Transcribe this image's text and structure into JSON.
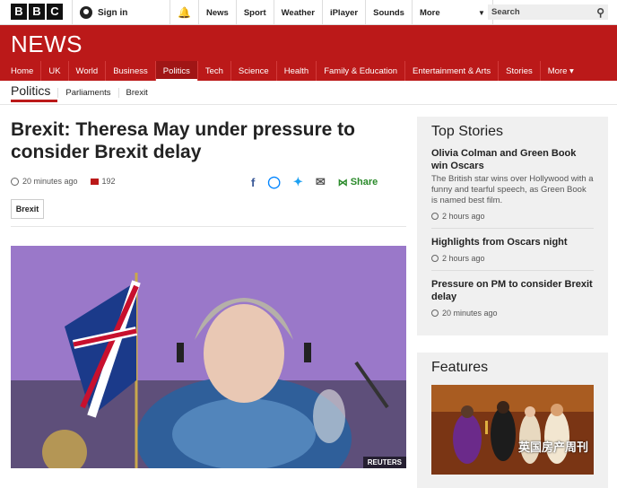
{
  "bbc_logo": [
    "B",
    "B",
    "C"
  ],
  "topbar": {
    "signin": "Sign in",
    "nav": [
      "News",
      "Sport",
      "Weather",
      "iPlayer",
      "Sounds",
      "More"
    ],
    "search_placeholder": "Search"
  },
  "news_wordmark": "NEWS",
  "main_nav": [
    "Home",
    "UK",
    "World",
    "Business",
    "Politics",
    "Tech",
    "Science",
    "Health",
    "Family & Education",
    "Entertainment & Arts",
    "Stories",
    "More ▾"
  ],
  "main_nav_active": "Politics",
  "sub_nav": {
    "current": "Politics",
    "items": [
      "Parliaments",
      "Brexit"
    ]
  },
  "article": {
    "headline": "Brexit: Theresa May under pressure to consider Brexit delay",
    "time": "20 minutes ago",
    "comments": "192",
    "share_label": "Share",
    "tag": "Brexit",
    "photo_credit": "REUTERS"
  },
  "top_stories": {
    "title": "Top Stories",
    "items": [
      {
        "headline": "Olivia Colman and Green Book win Oscars",
        "summary": "The British star wins over Hollywood with a funny and tearful speech, as Green Book is named best film.",
        "time": "2 hours ago"
      },
      {
        "headline": "Highlights from Oscars night",
        "summary": "",
        "time": "2 hours ago"
      },
      {
        "headline": "Pressure on PM to consider Brexit delay",
        "summary": "",
        "time": "20 minutes ago"
      }
    ]
  },
  "features": {
    "title": "Features"
  },
  "watermark": "英国房产周刊",
  "colors": {
    "brand_red": "#bb1919",
    "sidebar_bg": "#f0f0f0"
  }
}
